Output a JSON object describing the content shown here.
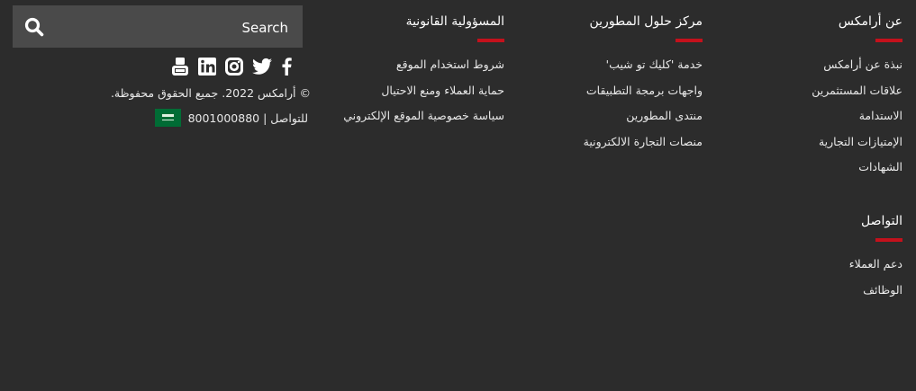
{
  "columns": {
    "about": {
      "title": "عن أرامكس",
      "links": [
        "نبذة عن أرامكس",
        "علاقات المستثمرين",
        "الاستدامة",
        "الإمتيازات التجارية",
        "الشهادات"
      ]
    },
    "developers": {
      "title": "مركز حلول المطورين",
      "links": [
        "خدمة 'كليك تو شيب'",
        "واجهات برمجة التطبيقات",
        "منتدى المطورين",
        "منصات التجارة الالكترونية"
      ]
    },
    "legal": {
      "title": "المسؤولية القانونية",
      "links": [
        "شروط استخدام الموقع",
        "حماية العملاء ومنع الاحتيال",
        "سياسة خصوصية الموقع الإلكتروني"
      ]
    },
    "contact": {
      "title": "التواصل",
      "links": [
        "دعم العملاء",
        "الوظائف"
      ]
    }
  },
  "search": {
    "placeholder": "Search"
  },
  "social_icons": [
    "youtube-icon",
    "linkedin-icon",
    "instagram-icon",
    "twitter-icon",
    "facebook-icon"
  ],
  "copyright": "© أرامكس 2022. جميع الحقوق محفوظة.",
  "phone": "للتواصل | 8001000880",
  "accent_color": "#c4111c"
}
